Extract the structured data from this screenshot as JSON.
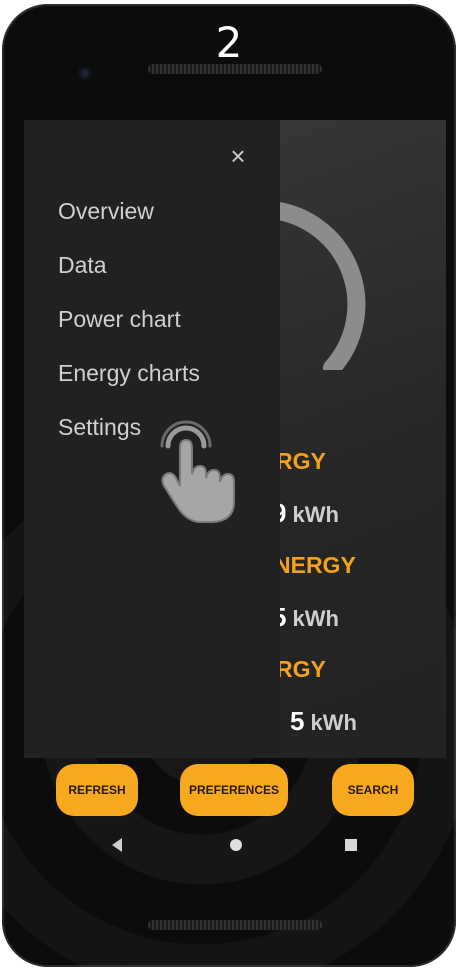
{
  "step": "2",
  "drawer": {
    "close_label": "×",
    "items": [
      {
        "label": "Overview"
      },
      {
        "label": "Data"
      },
      {
        "label": "Power chart"
      },
      {
        "label": "Energy charts"
      },
      {
        "label": "Settings"
      }
    ]
  },
  "energy": {
    "rows": [
      {
        "label": "RGY",
        "value": "9",
        "unit": "kWh"
      },
      {
        "label": "NERGY",
        "value": "5",
        "unit": "kWh"
      },
      {
        "label": "RGY",
        "value": "5",
        "unit": "kWh"
      }
    ]
  },
  "buttons": {
    "refresh": "REFRESH",
    "preferences": "PREFERENCES",
    "search": "SEARCH"
  },
  "colors": {
    "accent": "#f6a81f",
    "label_orange": "#f2a21b",
    "drawer_bg": "#212121"
  },
  "icons": {
    "close": "close-icon",
    "hand": "hand-pointer-icon",
    "back": "nav-back-icon",
    "home": "nav-home-icon",
    "recent": "nav-recent-icon"
  }
}
